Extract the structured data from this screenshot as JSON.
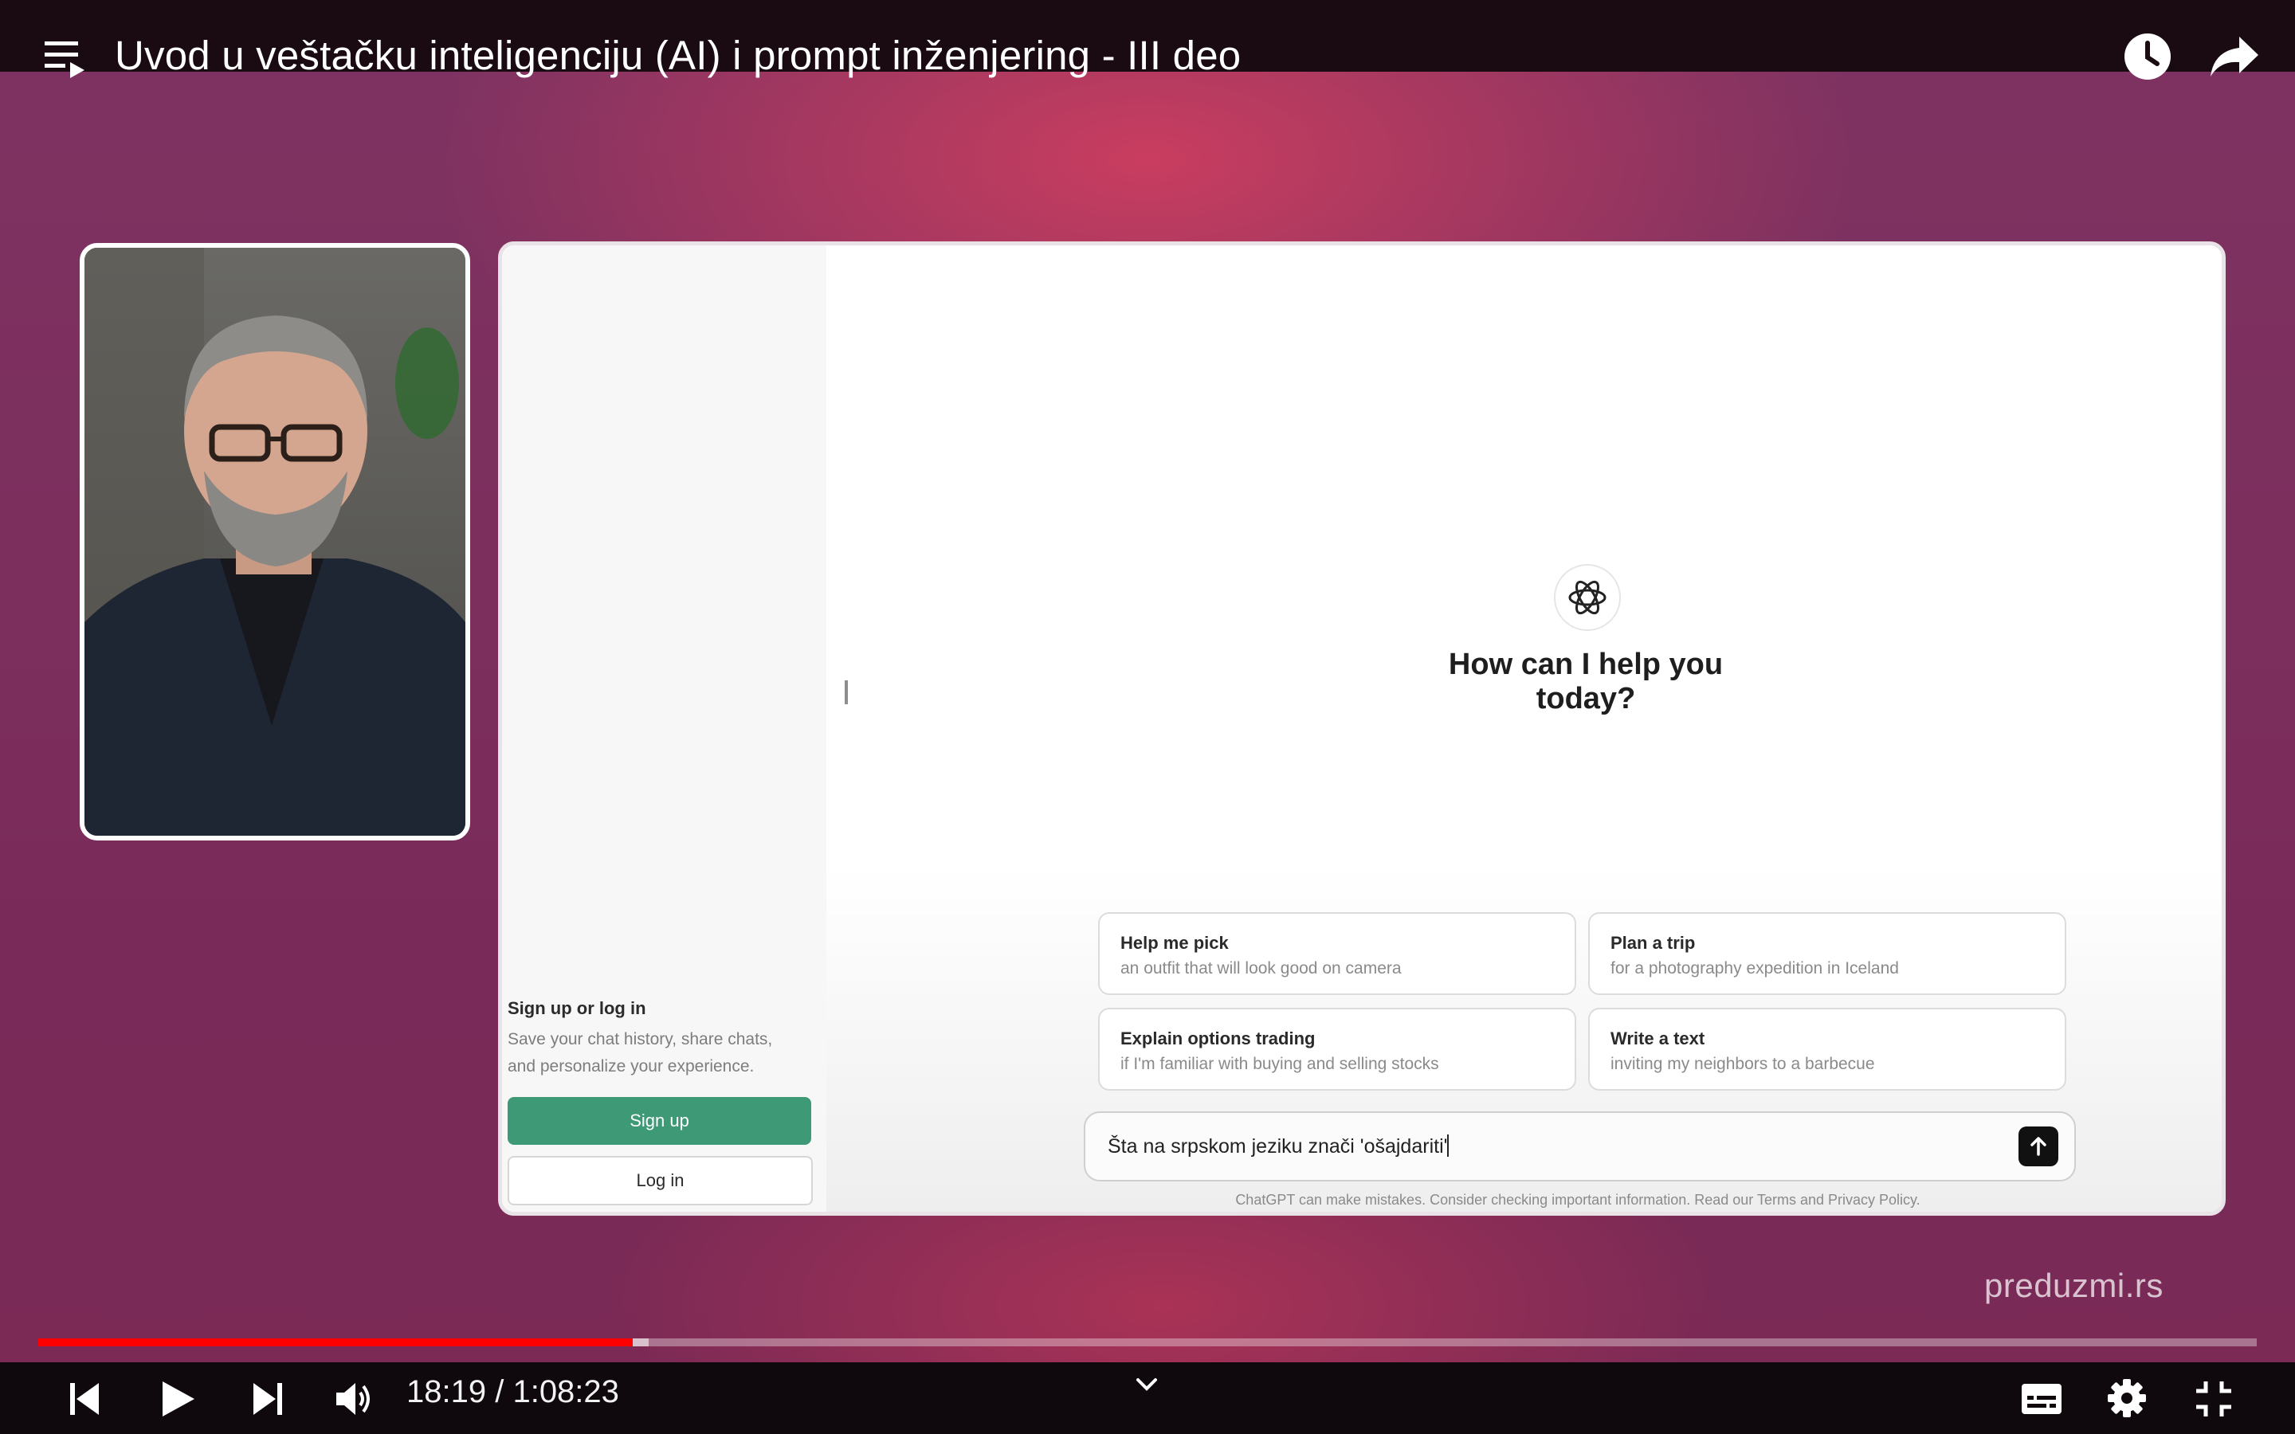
{
  "player": {
    "title": "Uvod u veštačku inteligenciju (AI) i prompt inženjering - III deo",
    "time_current": "18:19",
    "time_separator": " / ",
    "time_total": "1:08:23",
    "progress_played": 0.268,
    "progress_buffered": 0.275,
    "accent_color": "#ff0000"
  },
  "chatgpt": {
    "headline": "How can I help you today?",
    "sidebar": {
      "signup_title": "Sign up or log in",
      "signup_desc": "Save your chat history, share chats, and personalize your experience.",
      "signup_button": "Sign up",
      "login_button": "Log in",
      "signup_color": "#3e9977"
    },
    "suggestions": [
      {
        "title": "Help me pick",
        "subtitle": "an outfit that will look good on camera"
      },
      {
        "title": "Plan a trip",
        "subtitle": "for a photography expedition in Iceland"
      },
      {
        "title": "Explain options trading",
        "subtitle": "if I'm familiar with buying and selling stocks"
      },
      {
        "title": "Write a text",
        "subtitle": "inviting my neighbors to a barbecue"
      }
    ],
    "prompt_value": "Šta na srpskom jeziku znači 'ošajdariti'",
    "disclaimer": "ChatGPT can make mistakes. Consider checking important information. Read our Terms and Privacy Policy."
  },
  "watermark": "preduzmi.rs",
  "icons": [
    "playlist-icon",
    "watch-later-icon",
    "share-icon",
    "openai-logo-icon",
    "send-arrow-icon",
    "previous-icon",
    "play-icon",
    "next-icon",
    "volume-icon",
    "chevron-down-icon",
    "subtitles-icon",
    "settings-gear-icon",
    "exit-fullscreen-icon"
  ]
}
